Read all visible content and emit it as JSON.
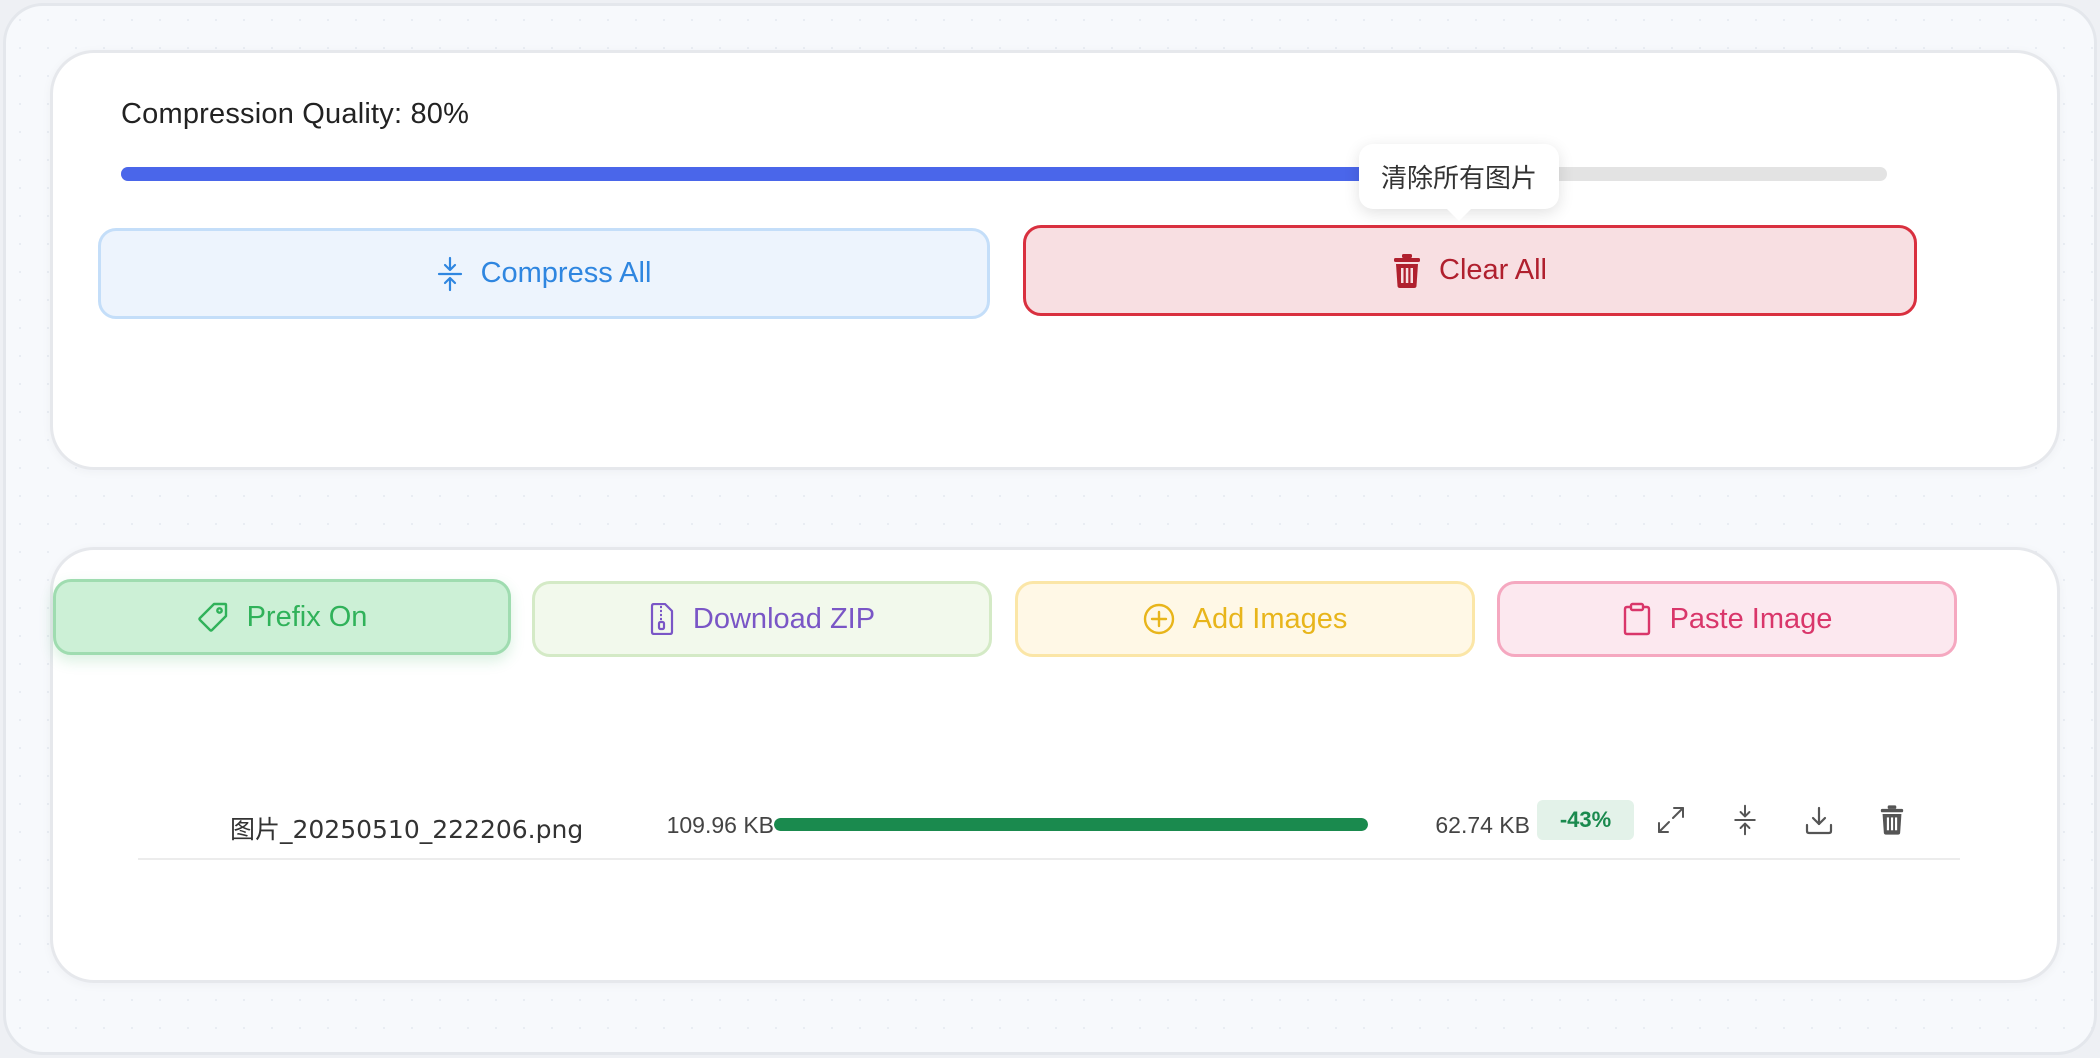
{
  "quality": {
    "label": "Compression Quality: 80%",
    "value_percent": 80,
    "slider_color": "#4a66ea"
  },
  "tooltip": {
    "text": "清除所有图片"
  },
  "actions_top": {
    "compress_all": {
      "label": "Compress All",
      "icon": "compress-icon"
    },
    "clear_all": {
      "label": "Clear All",
      "icon": "trash-icon"
    }
  },
  "actions_bottom": {
    "prefix": {
      "label": "Prefix On",
      "icon": "tag-icon"
    },
    "download_zip": {
      "label": "Download ZIP",
      "icon": "zip-file-icon"
    },
    "add_images": {
      "label": "Add Images",
      "icon": "plus-circle-icon"
    },
    "paste_image": {
      "label": "Paste Image",
      "icon": "clipboard-icon"
    }
  },
  "files": [
    {
      "name": "图片_20250510_222206.png",
      "original_size": "109.96 KB",
      "progress_percent": 100,
      "compressed_size": "62.74 KB",
      "reduction": "-43%",
      "actions": [
        "expand-icon",
        "compress-icon",
        "download-icon",
        "trash-icon"
      ]
    }
  ],
  "colors": {
    "accent_blue": "#2f86e0",
    "danger_red": "#d9303f",
    "success_green": "#1a8a4e",
    "prefix_green": "#30b25a",
    "zip_purple": "#7a56c6",
    "add_yellow": "#e8b51b",
    "paste_pink": "#d9366a"
  }
}
